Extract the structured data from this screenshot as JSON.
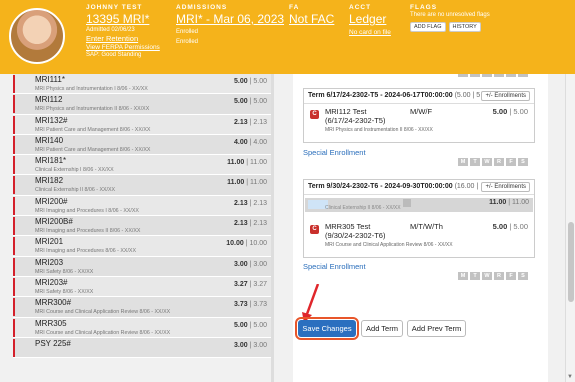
{
  "header": {
    "student_label": "JOHNNY TEST",
    "student_id": "13395 MRI*",
    "admitted": "Admitted 02/06/23",
    "enter_retention": "Enter Retention",
    "ferpa": "View FERPA Permissions",
    "sap": "SAP: Good Standing",
    "admissions_label": "ADMISSIONS",
    "admission_value": "MRI* - Mar 06, 2023",
    "enrolled1": "Enrolled",
    "enrolled2": "Enrolled",
    "fa_label": "FA",
    "fa_value": "Not FAC",
    "acct_label": "ACCT",
    "acct_value": "Ledger",
    "no_card": "No card on file",
    "flags_label": "FLAGS",
    "flags_note": "There are no unresolved flags",
    "add_flag": "ADD FLAG",
    "history": "HISTORY"
  },
  "courses": [
    {
      "name": "MRI111*",
      "sub": "MRI Physics and Instrumentation I    8/06 - XX/XX",
      "earned": "5.00",
      "total": "5.00"
    },
    {
      "name": "MRI112",
      "sub": "MRI Physics and Instrumentation II    8/06 - XX/XX",
      "earned": "5.00",
      "total": "5.00"
    },
    {
      "name": "MRI132#",
      "sub": "MRI Patient Care and Management    8/06 - XX/XX",
      "earned": "2.13",
      "total": "2.13"
    },
    {
      "name": "MRI140",
      "sub": "MRI Patient Care and Management    8/06 - XX/XX",
      "earned": "4.00",
      "total": "4.00"
    },
    {
      "name": "MRI181*",
      "sub": "Clinical Externship I    8/06 - XX/XX",
      "earned": "11.00",
      "total": "11.00"
    },
    {
      "name": "MRI182",
      "sub": "Clinical Externship II    8/06 - XX/XX",
      "earned": "11.00",
      "total": "11.00"
    },
    {
      "name": "MRI200#",
      "sub": "MRI Imaging and Procedures I    8/06 - XX/XX",
      "earned": "2.13",
      "total": "2.13"
    },
    {
      "name": "MRI200B#",
      "sub": "MRI Imaging and Procedures II    8/06 - XX/XX",
      "earned": "2.13",
      "total": "2.13"
    },
    {
      "name": "MRI201",
      "sub": "MRI Imaging and Procedures    8/06 - XX/XX",
      "earned": "10.00",
      "total": "10.00"
    },
    {
      "name": "MRI203",
      "sub": "MRI Safety    8/06 - XX/XX",
      "earned": "3.00",
      "total": "3.00"
    },
    {
      "name": "MRI203#",
      "sub": "MRI Safety    8/06 - XX/XX",
      "earned": "3.27",
      "total": "3.27"
    },
    {
      "name": "MRR300#",
      "sub": "MRI Course and Clinical Application Review    8/06 - XX/XX",
      "earned": "3.73",
      "total": "3.73"
    },
    {
      "name": "MRR305",
      "sub": "MRI Course and Clinical Application Review    8/06 - XX/XX",
      "earned": "5.00",
      "total": "5.00"
    },
    {
      "name": "PSY 225#",
      "sub": "",
      "earned": "3.00",
      "total": "3.00"
    }
  ],
  "days": [
    "M",
    "T",
    "W",
    "R",
    "F",
    "S"
  ],
  "term1": {
    "title": "Term 6/17/24-2302-T5 - 2024-06-17T00:00:00",
    "credits": "(5.00 | 5",
    "enroll_button": "+/- Enrollments",
    "course": {
      "badge": "C",
      "name": "MRI112 Test",
      "name2": "(6/17/24-2302-T5)",
      "days": "M/W/F",
      "earned": "5.00",
      "total": "5.00",
      "sub": "MRI Physics and Instrumentation II    8/06 - XX/XX"
    }
  },
  "special_enrollment_1": "Special Enrollment",
  "term2": {
    "title": "Term 9/30/24-2302-T6 - 2024-09-30T00:00:00",
    "credits": "(16.00 |",
    "enroll_button": "+/- Enrollments",
    "highlight": {
      "sub": "Clinical Externship II    8/06 - XX/XX",
      "earned": "11.00",
      "total": "11.00"
    },
    "course": {
      "badge": "C",
      "name": "MRR305 Test",
      "name2": "(9/30/24-2302-T6)",
      "days": "M/T/W/Th",
      "earned": "5.00",
      "total": "5.00",
      "sub": "MRI Course and Clinical Application Review    8/06 - XX/XX"
    }
  },
  "special_enrollment_2": "Special Enrollment",
  "buttons": {
    "save": "Save Changes",
    "add_term": "Add Term",
    "add_prev_term": "Add Prev Term"
  }
}
